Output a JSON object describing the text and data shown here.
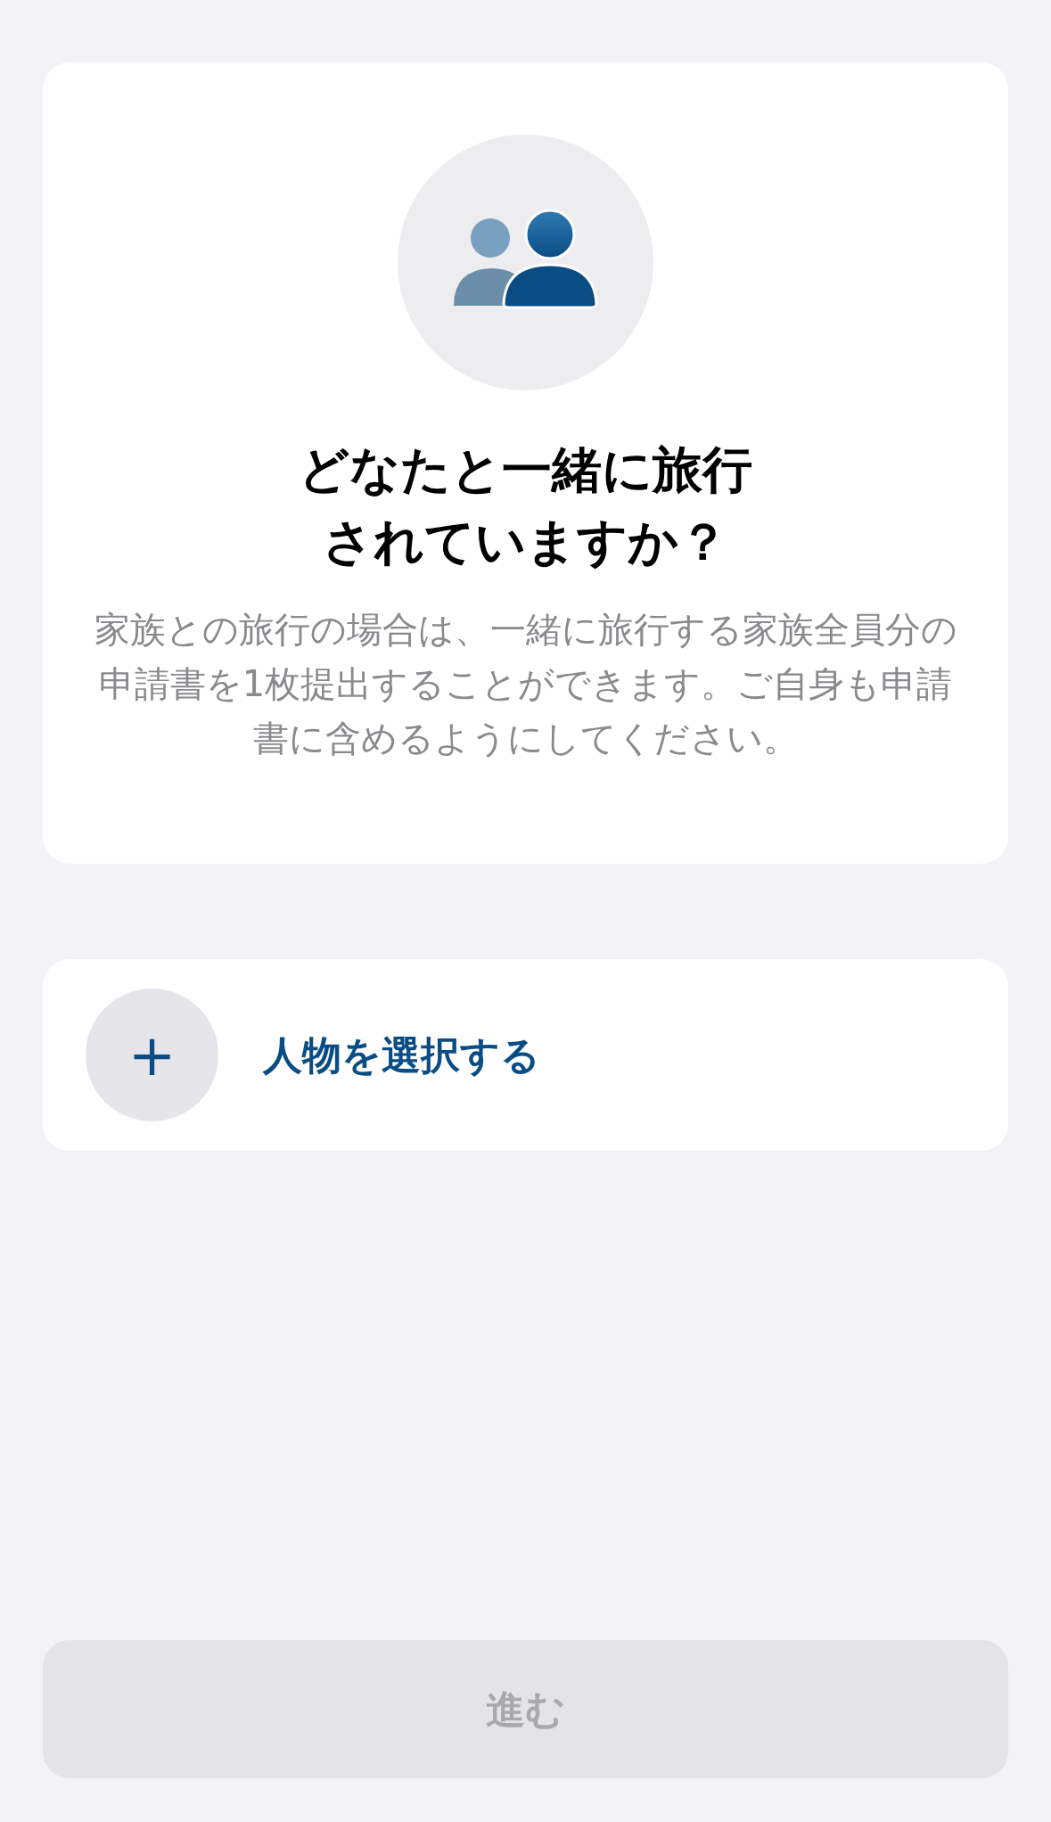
{
  "intro_card": {
    "title_lines": [
      "どなたと一緒に旅行",
      "されていますか？"
    ],
    "description": "家族との旅行の場合は、一緒に旅行する家族全員分の申請書を1枚提出することができます。ご自身も申請書に含めるようにしてください。"
  },
  "add_person": {
    "icon": "+",
    "label": "人物を選択する"
  },
  "next_button": {
    "label": "進む",
    "disabled": true
  }
}
